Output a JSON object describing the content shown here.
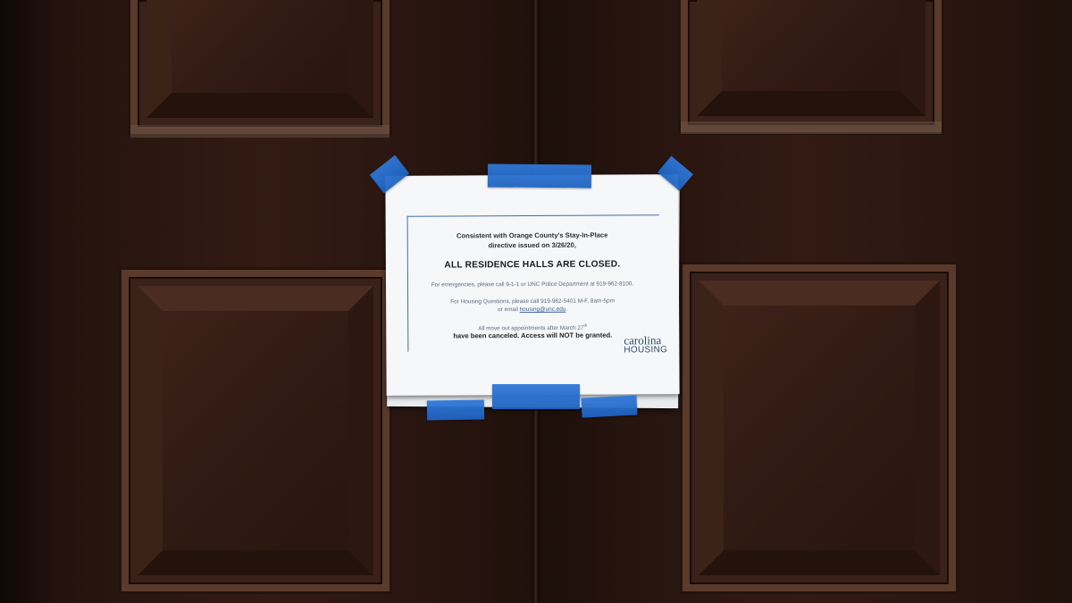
{
  "notice": {
    "intro_line1": "Consistent with Orange County's Stay-In-Place",
    "intro_line2": "directive issued on 3/26/20,",
    "headline": "ALL RESIDENCE HALLS ARE CLOSED.",
    "emergency": "For emergencies, please call 9-1-1 or UNC Police Department at 919-962-8100.",
    "housing_line1": "For Housing Questions, please call 919-962-5401 M-F, 8am-5pm",
    "housing_line2_prefix": "or email ",
    "housing_email": "housing@unc.edu",
    "housing_line2_suffix": ".",
    "moveout_line1_prefix": "All move out appointments after March 27",
    "moveout_line1_sup": "th",
    "moveout_line2": "have been canceled. Access will NOT be granted.",
    "logo_line1": "carolina",
    "logo_line2": "HOUSING"
  },
  "colors": {
    "tape": "#2a70d2",
    "door": "#2a1610",
    "paper": "#f6f7f8",
    "accent_line": "#3c6fa6"
  }
}
